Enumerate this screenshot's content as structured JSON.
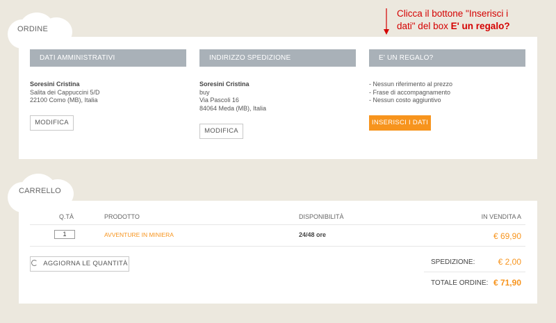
{
  "annotation": {
    "line1": "Clicca il bottone \"Inserisci i",
    "line2_prefix": "dati\" del box ",
    "line2_bold": "E' un regalo?"
  },
  "order": {
    "tab_label": "ORDINE",
    "admin": {
      "header": "DATI AMMINISTRATIVI",
      "name": "Soresini Cristina",
      "lines": [
        "Salita dei Cappuccini 5/D",
        "22100 Como (MB), Italia"
      ],
      "button": "MODIFICA"
    },
    "shipping": {
      "header": "INDIRIZZO SPEDIZIONE",
      "name": "Soresini Cristina",
      "lines": [
        "buy",
        "Via Pascoli 16",
        "84064 Meda (MB), Italia"
      ],
      "button": "MODIFICA"
    },
    "gift": {
      "header": "E' UN REGALO?",
      "lines": [
        "- Nessun riferimento al prezzo",
        "- Frase di accompagnamento",
        "- Nessun costo aggiuntivo"
      ],
      "button": "INSERISCI I DATI"
    }
  },
  "cart": {
    "tab_label": "CARRELLO",
    "columns": {
      "qty": "Q.TÀ",
      "product": "PRODOTTO",
      "availability": "DISPONIBILITÀ",
      "price": "IN VENDITA A"
    },
    "row": {
      "qty": "1",
      "product": "AVVENTURE IN MINIERA",
      "availability": "24/48 ore",
      "price": "€ 69,90"
    },
    "update_button": "AGGIORNA LE QUANTITÀ",
    "shipping_label": "SPEDIZIONE:",
    "shipping_value": "€ 2,00",
    "total_label": "TOTALE ORDINE:",
    "total_value": "€ 71,90"
  },
  "colors": {
    "accent": "#f7941d",
    "header_bg": "#a9b1b8",
    "annotation": "#d40000",
    "page_bg": "#ece8de"
  }
}
